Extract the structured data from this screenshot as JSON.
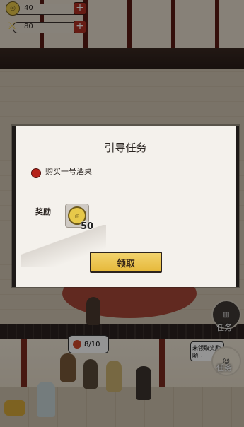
{
  "resources": {
    "coins": {
      "value": "40",
      "icon": "coin-icon"
    },
    "reputation": {
      "value": "80",
      "icon": "reputation-icon"
    }
  },
  "dialog": {
    "title": "引导任务",
    "task_text": "购买一号酒桌",
    "reward_label": "奖励",
    "reward_count": "50",
    "claim_label": "领取"
  },
  "hud": {
    "stage_counter": "8/10",
    "speech_text": "未领取奖励哟~",
    "task_button_label": "任务",
    "side_button_label": "任务"
  },
  "colors": {
    "accent_red": "#b23124",
    "button_gold": "#e6b93a",
    "dialog_bg": "#f4f1ec"
  }
}
